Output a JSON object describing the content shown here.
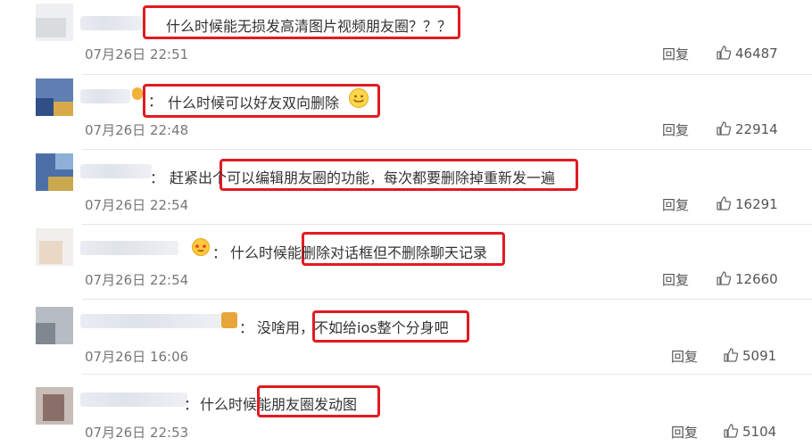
{
  "comments": [
    {
      "text": "什么时候能无损发高清图片视频朋友圈？？？",
      "time": "07月26日 22:51",
      "reply": "回复",
      "likes": "46487"
    },
    {
      "text": "什么时候可以好友双向删除",
      "time": "07月26日 22:48",
      "reply": "回复",
      "likes": "22914"
    },
    {
      "text": "赶紧出个可以编辑朋友圈的功能，每次都要删除掉重新发一遍",
      "time": "07月26日 22:54",
      "reply": "回复",
      "likes": "16291"
    },
    {
      "text": "什么时候能删除对话框但不删除聊天记录",
      "time": "07月26日 22:54",
      "reply": "回复",
      "likes": "12660"
    },
    {
      "text": "没啥用，不如给ios整个分身吧",
      "time": "07月26日 16:06",
      "reply": "回复",
      "likes": "5091"
    },
    {
      "text": "什么时候能朋友圈发动图",
      "time": "07月26日 22:53",
      "reply": "回复",
      "likes": "5104"
    }
  ],
  "colors": {
    "highlight_box": "#e11b22",
    "timestamp": "#777777",
    "divider": "#e6e6e6"
  },
  "icons": {
    "like": "thumbs-up-icon"
  }
}
